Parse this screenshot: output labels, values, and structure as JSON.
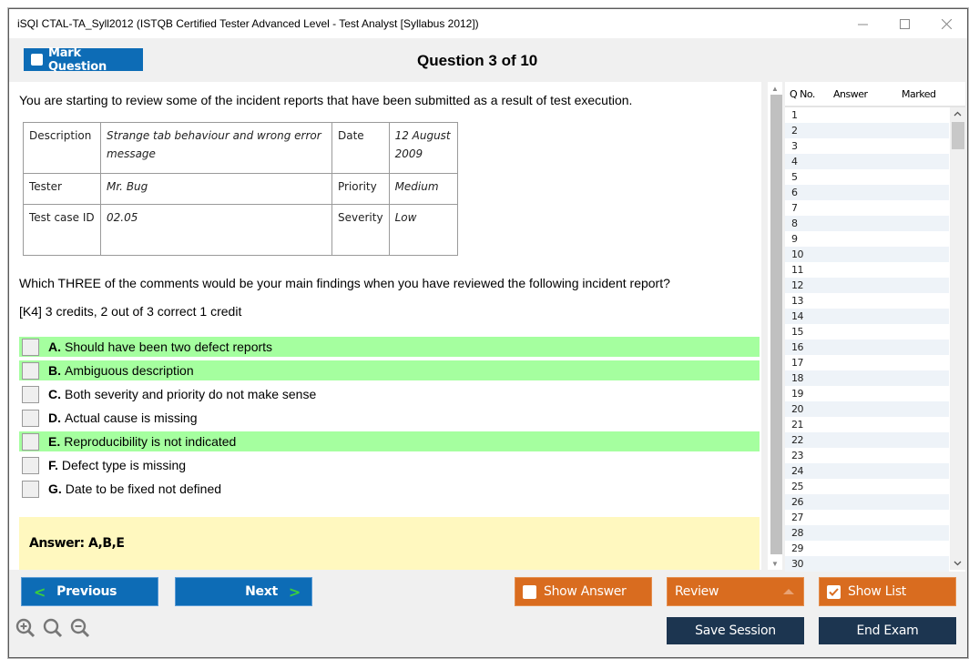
{
  "window": {
    "title": "iSQI CTAL-TA_Syll2012 (ISTQB Certified Tester Advanced Level - Test Analyst [Syllabus 2012])",
    "controls": [
      "minimize",
      "maximize",
      "close"
    ]
  },
  "header": {
    "mark_question_label": "Mark Question",
    "question_counter": "Question 3 of 10"
  },
  "question": {
    "intro": "You are starting to review some of the incident reports that have been submitted as a result of test execution.",
    "incident_table": {
      "rows": [
        {
          "label1": "Description",
          "value1": "Strange tab behaviour and wrong error message",
          "label2": "Date",
          "value2": "12 August 2009"
        },
        {
          "label1": "Tester",
          "value1": "Mr. Bug",
          "label2": "Priority",
          "value2": "Medium"
        },
        {
          "label1": "Test case ID",
          "value1": "02.05",
          "label2": "Severity",
          "value2": "Low"
        }
      ]
    },
    "text": "Which THREE of the comments would be your main findings when you have reviewed the following incident report?",
    "credits": "[K4] 3 credits, 2 out of 3 correct 1 credit",
    "options": [
      {
        "letter": "A.",
        "text": "Should have been two defect reports",
        "correct": true,
        "checked": false
      },
      {
        "letter": "B.",
        "text": "Ambiguous description",
        "correct": true,
        "checked": false
      },
      {
        "letter": "C.",
        "text": "Both severity and priority do not make sense",
        "correct": false,
        "checked": false
      },
      {
        "letter": "D.",
        "text": "Actual cause is missing",
        "correct": false,
        "checked": false
      },
      {
        "letter": "E.",
        "text": "Reproducibility is not indicated",
        "correct": true,
        "checked": false
      },
      {
        "letter": "F.",
        "text": "Defect type is missing",
        "correct": false,
        "checked": false
      },
      {
        "letter": "G.",
        "text": "Date to be fixed not defined",
        "correct": false,
        "checked": false
      }
    ],
    "answer": "Answer: A,B,E"
  },
  "question_list": {
    "headers": {
      "qno": "Q No.",
      "answer": "Answer",
      "marked": "Marked"
    },
    "rows": [
      "1",
      "2",
      "3",
      "4",
      "5",
      "6",
      "7",
      "8",
      "9",
      "10",
      "11",
      "12",
      "13",
      "14",
      "15",
      "16",
      "17",
      "18",
      "19",
      "20",
      "21",
      "22",
      "23",
      "24",
      "25",
      "26",
      "27",
      "28",
      "29",
      "30"
    ]
  },
  "footer": {
    "previous_label": "Previous",
    "next_label": "Next",
    "show_answer_label": "Show Answer",
    "show_answer_checked": false,
    "review_label": "Review",
    "show_list_label": "Show List",
    "show_list_checked": true,
    "save_session_label": "Save Session",
    "end_exam_label": "End Exam",
    "zoom_icons": [
      "zoom-in-icon",
      "zoom-reset-icon",
      "zoom-out-icon"
    ]
  },
  "colors": {
    "primary_blue": "#0d6cb6",
    "orange": "#d96c1f",
    "navy": "#1c3550",
    "correct_highlight": "#a5ff9f",
    "answer_bg": "#fff8bf",
    "chevron_green": "#3ccf3c"
  }
}
